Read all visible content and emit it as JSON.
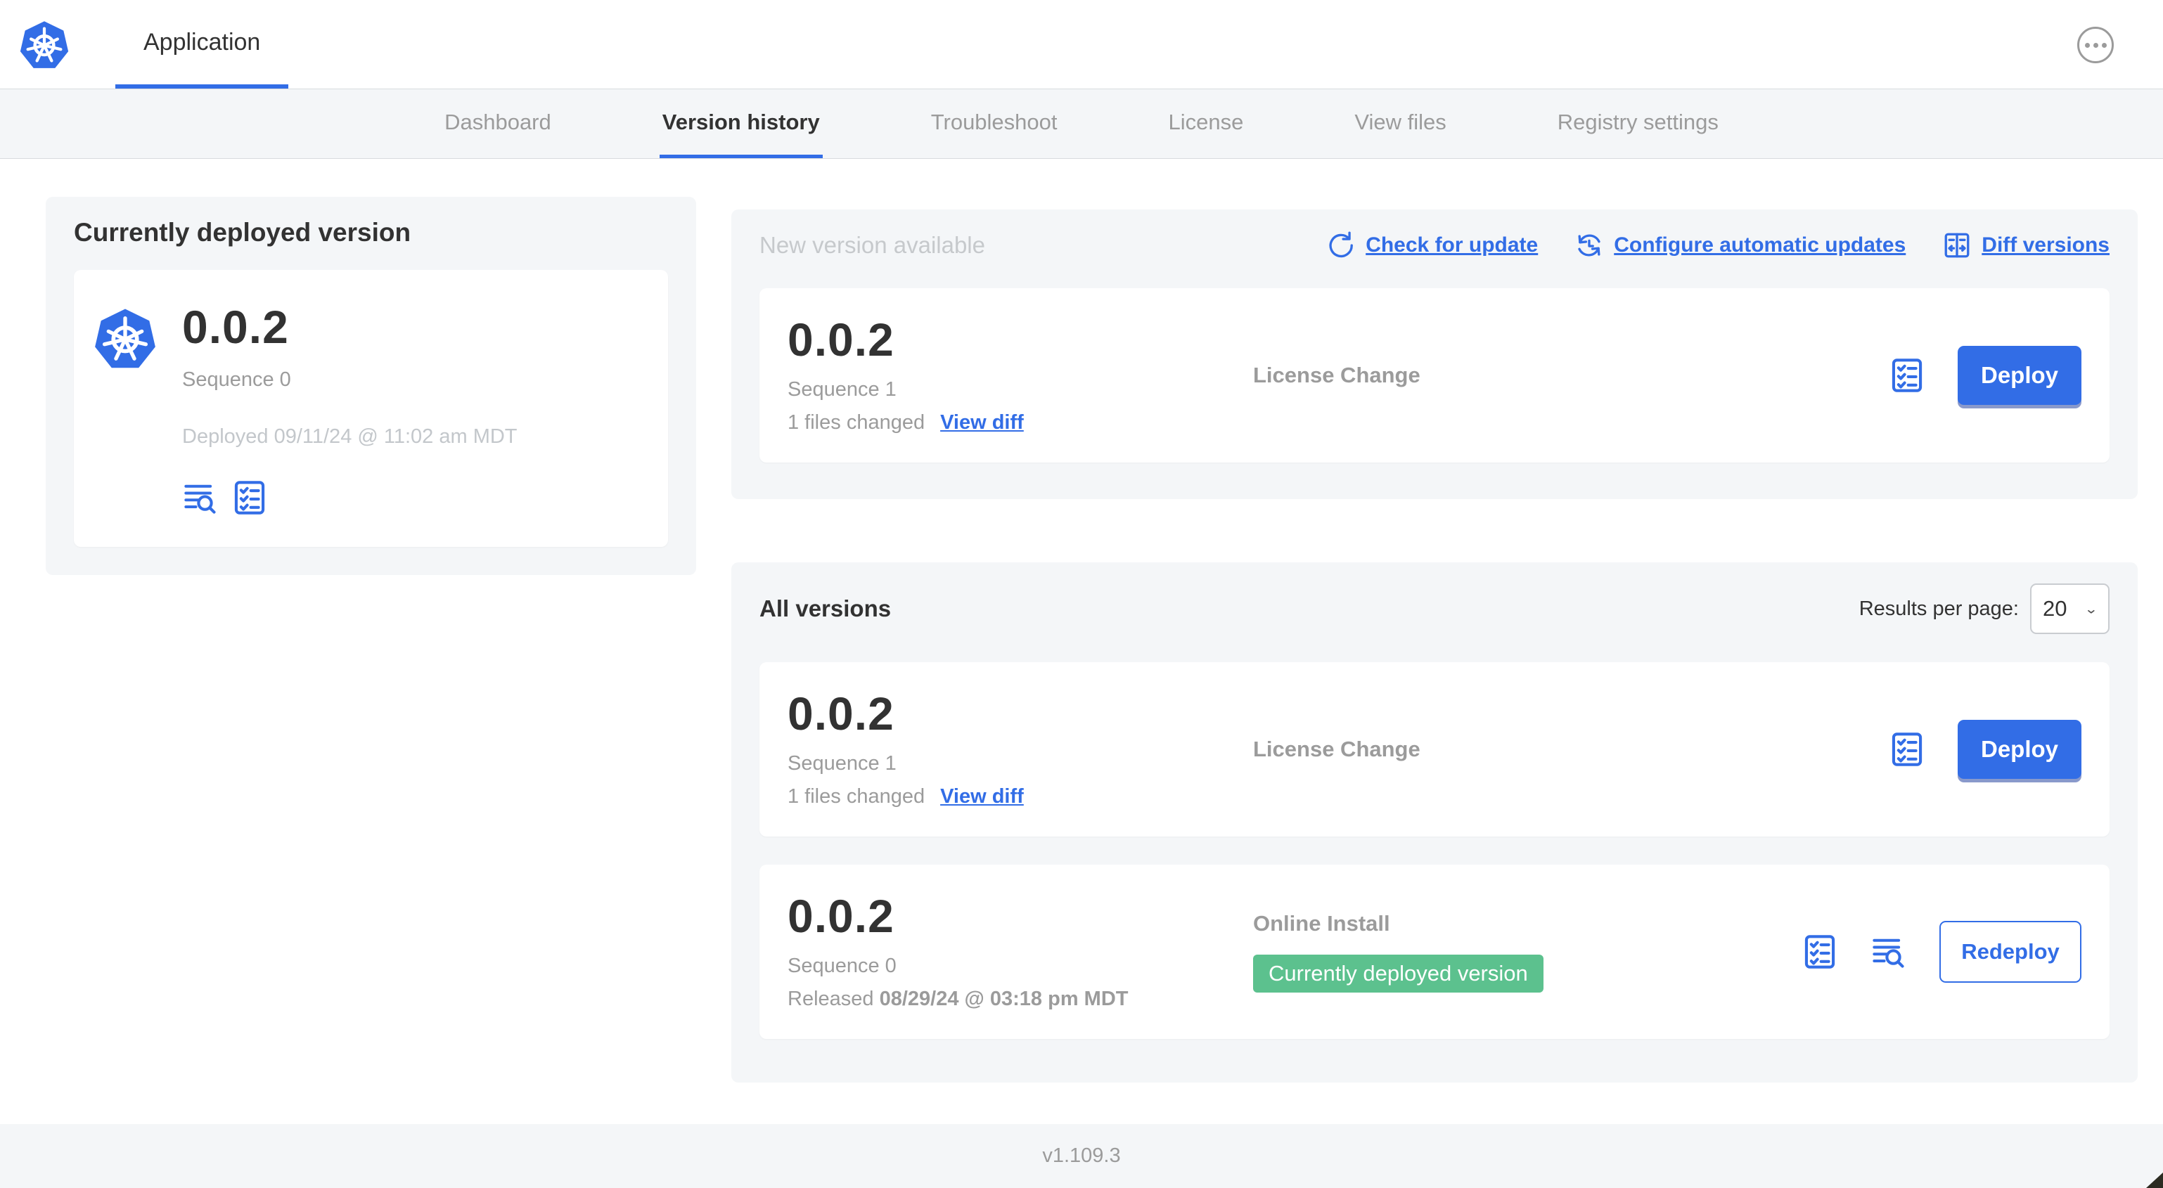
{
  "colors": {
    "accent_blue": "#326de6",
    "badge_green": "#5cc18e",
    "panel_gray": "#f4f6f8",
    "muted_text": "#9b9b9b",
    "faint_text": "#c6c9cc",
    "dark_text": "#323232"
  },
  "header": {
    "app_tab_label": "Application",
    "logo_icon": "kubernetes-logo-icon",
    "more_icon": "ellipsis-circle-icon"
  },
  "nav": {
    "tabs": [
      {
        "label": "Dashboard",
        "active": false
      },
      {
        "label": "Version history",
        "active": true
      },
      {
        "label": "Troubleshoot",
        "active": false
      },
      {
        "label": "License",
        "active": false
      },
      {
        "label": "View files",
        "active": false
      },
      {
        "label": "Registry settings",
        "active": false
      }
    ]
  },
  "current_version_card": {
    "title": "Currently deployed version",
    "version": "0.0.2",
    "sequence": "Sequence 0",
    "deployed": "Deployed 09/11/24 @ 11:02 am MDT",
    "icons": [
      "logs-icon",
      "checklist-icon"
    ]
  },
  "new_version_panel": {
    "title": "New version available",
    "actions": [
      {
        "label": "Check for update",
        "icon": "refresh-icon"
      },
      {
        "label": "Configure automatic updates",
        "icon": "auto-update-clock-icon"
      },
      {
        "label": "Diff versions",
        "icon": "diff-icon"
      }
    ],
    "row": {
      "version": "0.0.2",
      "sequence": "Sequence 1",
      "files_changed": "1 files changed",
      "view_diff_label": "View diff",
      "source": "License Change",
      "deploy_label": "Deploy"
    }
  },
  "all_versions_panel": {
    "title": "All versions",
    "results_per_page_label": "Results per page:",
    "results_per_page_value": "20",
    "rows": [
      {
        "version": "0.0.2",
        "sequence": "Sequence 1",
        "files_changed": "1 files changed",
        "view_diff_label": "View diff",
        "source": "License Change",
        "action_label": "Deploy"
      },
      {
        "version": "0.0.2",
        "sequence": "Sequence 0",
        "released_prefix": "Released",
        "released_date": "08/29/24 @ 03:18 pm MDT",
        "source": "Online Install",
        "badge": "Currently deployed version",
        "action_label": "Redeploy"
      }
    ]
  },
  "footer": {
    "version": "v1.109.3"
  }
}
